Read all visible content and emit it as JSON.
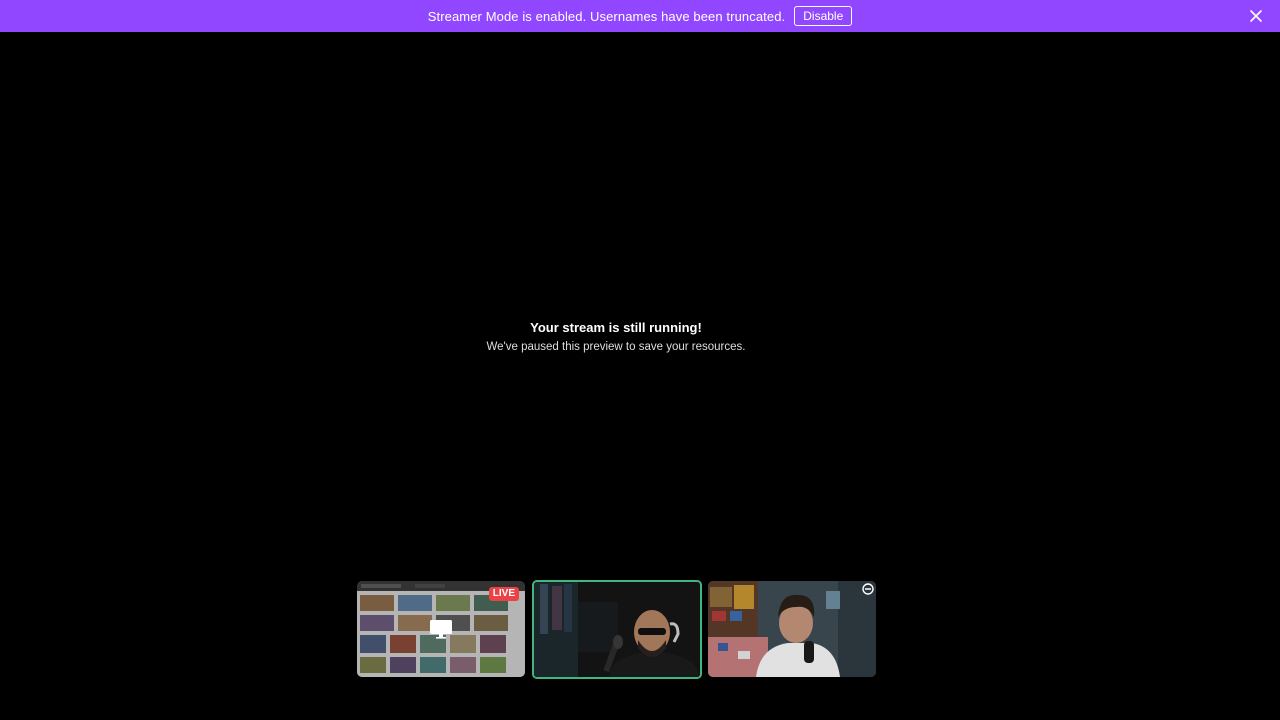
{
  "banner": {
    "message": "Streamer Mode is enabled. Usernames have been truncated.",
    "disable_label": "Disable",
    "close_icon": "close-icon",
    "background": "#9147ff"
  },
  "stage": {
    "title": "Your stream is still running!",
    "subtitle": "We've paused this preview to save your resources."
  },
  "participants": [
    {
      "type": "screen-share",
      "badge": "LIVE",
      "badge_color": "#ed4245",
      "icon": "screen-share-icon"
    },
    {
      "type": "camera",
      "speaking": true,
      "speaking_border_color": "#43b581"
    },
    {
      "type": "camera",
      "icon": "corner-icon"
    }
  ]
}
